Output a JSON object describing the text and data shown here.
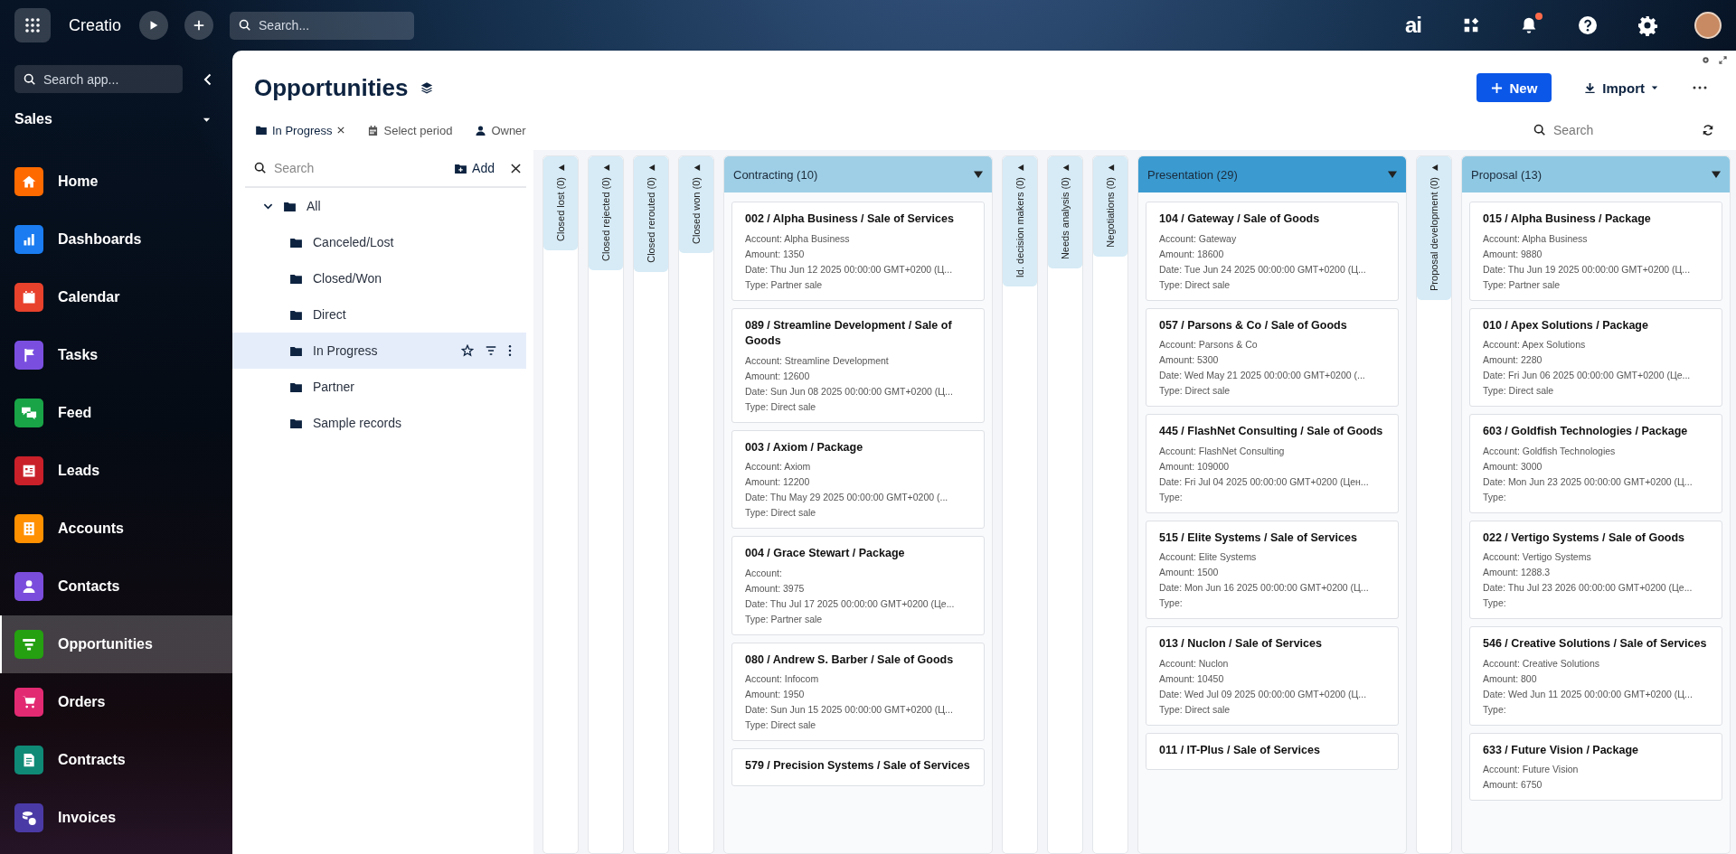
{
  "topbar": {
    "logo": "Creatio",
    "search_placeholder": "Search...",
    "ai_label": "ai",
    "notification_dot": true
  },
  "sidebar": {
    "search_placeholder": "Search app...",
    "workspace": "Sales",
    "items": [
      {
        "label": "Home",
        "color": "#ff6a00",
        "selected": false
      },
      {
        "label": "Dashboards",
        "color": "#1a7cf0",
        "selected": false
      },
      {
        "label": "Calendar",
        "color": "#e8412c",
        "selected": false
      },
      {
        "label": "Tasks",
        "color": "#7a4fe0",
        "selected": false
      },
      {
        "label": "Feed",
        "color": "#18a447",
        "selected": false
      },
      {
        "label": "Leads",
        "color": "#c9202a",
        "selected": false
      },
      {
        "label": "Accounts",
        "color": "#ff9000",
        "selected": false
      },
      {
        "label": "Contacts",
        "color": "#7b4ddc",
        "selected": false
      },
      {
        "label": "Opportunities",
        "color": "#24a010",
        "selected": true
      },
      {
        "label": "Orders",
        "color": "#e22a72",
        "selected": false
      },
      {
        "label": "Contracts",
        "color": "#0f8a76",
        "selected": false
      },
      {
        "label": "Invoices",
        "color": "#4a3aa6",
        "selected": false
      }
    ]
  },
  "page": {
    "title": "Opportunities",
    "new_button": "New",
    "import_button": "Import"
  },
  "filters": [
    {
      "kind": "folder",
      "label": "In Progress",
      "removable": true
    },
    {
      "kind": "period",
      "label": "Select period",
      "removable": false
    },
    {
      "kind": "owner",
      "label": "Owner",
      "removable": false
    }
  ],
  "search": {
    "placeholder": "Search"
  },
  "folders": {
    "search_placeholder": "Search",
    "add_button": "Add",
    "tree": [
      {
        "label": "All",
        "expanded": true,
        "selected": false,
        "children": [
          {
            "label": "Canceled/Lost",
            "selected": false
          },
          {
            "label": "Closed/Won",
            "selected": false
          },
          {
            "label": "Direct",
            "selected": false
          },
          {
            "label": "In Progress",
            "selected": true
          },
          {
            "label": "Partner",
            "selected": false
          },
          {
            "label": "Sample records",
            "selected": false
          }
        ]
      }
    ]
  },
  "board": {
    "columns": [
      {
        "kind": "collapsed",
        "title": "Closed lost (0)",
        "color": "#d6ebf6"
      },
      {
        "kind": "collapsed",
        "title": "Closed rejected (0)",
        "color": "#d6ebf6"
      },
      {
        "kind": "collapsed",
        "title": "Closed rerouted (0)",
        "color": "#d6ebf6"
      },
      {
        "kind": "collapsed",
        "title": "Closed won (0)",
        "color": "#d6ebf6"
      },
      {
        "kind": "expanded",
        "title": "Contracting (10)",
        "color": "#9fcfe6",
        "cards": [
          {
            "title": "002 / Alpha Business / Sale of Services",
            "lines": [
              "Account: Alpha Business",
              "Amount: 1350",
              "Date: Thu Jun 12 2025 00:00:00 GMT+0200 (Ц...",
              "Type: Partner sale"
            ]
          },
          {
            "title": "089 / Streamline Development / Sale of Goods",
            "lines": [
              "Account: Streamline Development",
              "Amount: 12600",
              "Date: Sun Jun 08 2025 00:00:00 GMT+0200 (Ц...",
              "Type: Direct sale"
            ]
          },
          {
            "title": "003 / Axiom / Package",
            "lines": [
              "Account: Axiom",
              "Amount: 12200",
              "Date: Thu May 29 2025 00:00:00 GMT+0200 (...",
              "Type: Direct sale"
            ]
          },
          {
            "title": "004 / Grace Stewart / Package",
            "lines": [
              "Account:",
              "Amount: 3975",
              "Date: Thu Jul 17 2025 00:00:00 GMT+0200 (Це...",
              "Type: Partner sale"
            ]
          },
          {
            "title": "080 / Andrew S. Barber / Sale of Goods",
            "lines": [
              "Account: Infocom",
              "Amount: 1950",
              "Date: Sun Jun 15 2025 00:00:00 GMT+0200 (Ц...",
              "Type: Direct sale"
            ]
          },
          {
            "title": "579 / Precision Systems / Sale of Services"
          }
        ]
      },
      {
        "kind": "collapsed",
        "title": "Id. decision makers (0)",
        "color": "#d6ebf6"
      },
      {
        "kind": "collapsed",
        "title": "Needs analysis (0)",
        "color": "#d6ebf6"
      },
      {
        "kind": "collapsed",
        "title": "Negotiations (0)",
        "color": "#d6ebf6"
      },
      {
        "kind": "expanded",
        "title": "Presentation (29)",
        "color": "#3b9bd1",
        "cards": [
          {
            "title": "104 / Gateway / Sale of Goods",
            "lines": [
              "Account: Gateway",
              "Amount: 18600",
              "Date: Tue Jun 24 2025 00:00:00 GMT+0200 (Ц...",
              "Type: Direct sale"
            ]
          },
          {
            "title": "057 / Parsons & Co / Sale of Goods",
            "lines": [
              "Account: Parsons & Co",
              "Amount: 5300",
              "Date: Wed May 21 2025 00:00:00 GMT+0200 (...",
              "Type: Direct sale"
            ]
          },
          {
            "title": "445 / FlashNet Consulting / Sale of Goods",
            "lines": [
              "Account: FlashNet Consulting",
              "Amount: 109000",
              "Date: Fri Jul 04 2025 00:00:00 GMT+0200 (Цен...",
              "Type:"
            ]
          },
          {
            "title": "515 / Elite Systems / Sale of Services",
            "lines": [
              "Account: Elite Systems",
              "Amount: 1500",
              "Date: Mon Jun 16 2025 00:00:00 GMT+0200 (Ц...",
              "Type:"
            ]
          },
          {
            "title": "013 / Nuclon / Sale of Services",
            "lines": [
              "Account: Nuclon",
              "Amount: 10450",
              "Date: Wed Jul 09 2025 00:00:00 GMT+0200 (Ц...",
              "Type: Direct sale"
            ]
          },
          {
            "title": "011 / IT-Plus / Sale of Services"
          }
        ]
      },
      {
        "kind": "collapsed",
        "title": "Proposal development (0)",
        "color": "#d6ebf6"
      },
      {
        "kind": "expanded",
        "title": "Proposal (13)",
        "color": "#8fc8e3",
        "cards": [
          {
            "title": "015 / Alpha Business / Package",
            "lines": [
              "Account: Alpha Business",
              "Amount: 9880",
              "Date: Thu Jun 19 2025 00:00:00 GMT+0200 (Ц...",
              "Type: Partner sale"
            ]
          },
          {
            "title": "010 / Apex Solutions / Package",
            "lines": [
              "Account: Apex Solutions",
              "Amount: 2280",
              "Date: Fri Jun 06 2025 00:00:00 GMT+0200 (Це...",
              "Type: Direct sale"
            ]
          },
          {
            "title": "603 / Goldfish Technologies / Package",
            "lines": [
              "Account: Goldfish Technologies",
              "Amount: 3000",
              "Date: Mon Jun 23 2025 00:00:00 GMT+0200 (Ц...",
              "Type:"
            ]
          },
          {
            "title": "022 / Vertigo Systems / Sale of Goods",
            "lines": [
              "Account: Vertigo Systems",
              "Amount: 1288.3",
              "Date: Thu Jul 23 2026 00:00:00 GMT+0200 (Це...",
              "Type:"
            ]
          },
          {
            "title": "546 / Creative Solutions / Sale of Services",
            "lines": [
              "Account: Creative Solutions",
              "Amount: 800",
              "Date: Wed Jun 11 2025 00:00:00 GMT+0200 (Ц...",
              "Type:"
            ]
          },
          {
            "title": "633 / Future Vision / Package",
            "lines": [
              "Account: Future Vision",
              "Amount: 6750"
            ]
          }
        ]
      }
    ]
  }
}
